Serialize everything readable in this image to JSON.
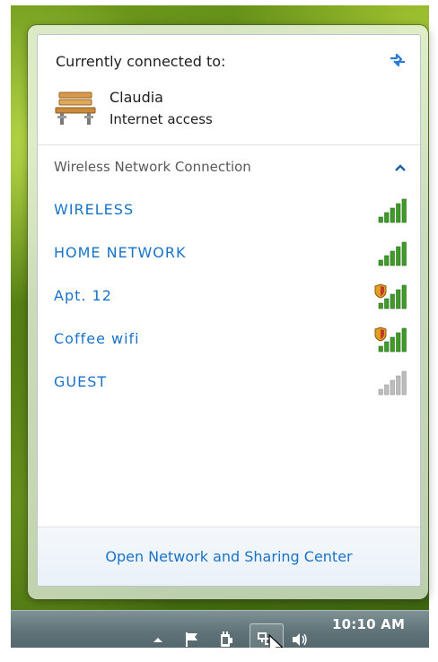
{
  "flyout": {
    "header": "Currently connected to:",
    "connected": {
      "name": "Claudia",
      "status": "Internet access",
      "icon": "bench-icon"
    },
    "section_title": "Wireless Network Connection",
    "networks": [
      {
        "label": "WIRELESS",
        "signal_bars": 5,
        "secured": false
      },
      {
        "label": "HOME NETWORK",
        "signal_bars": 5,
        "secured": false
      },
      {
        "label": "Apt. 12",
        "signal_bars": 5,
        "secured": true
      },
      {
        "label": "Coffee wifi",
        "signal_bars": 5,
        "secured": true
      },
      {
        "label": "GUEST",
        "signal_bars": 0,
        "secured": false
      }
    ],
    "footer_link": "Open Network and Sharing Center"
  },
  "taskbar": {
    "clock": "10:10 AM",
    "tray_icons": [
      "show-hidden-icons-arrow",
      "action-center-flag-icon",
      "power-icon",
      "network-icon",
      "volume-icon"
    ]
  },
  "colors": {
    "link": "#1a73c8",
    "signal_green": "#3f9a2a",
    "signal_gray": "#bdbdbd",
    "shield": "#e0a020"
  }
}
